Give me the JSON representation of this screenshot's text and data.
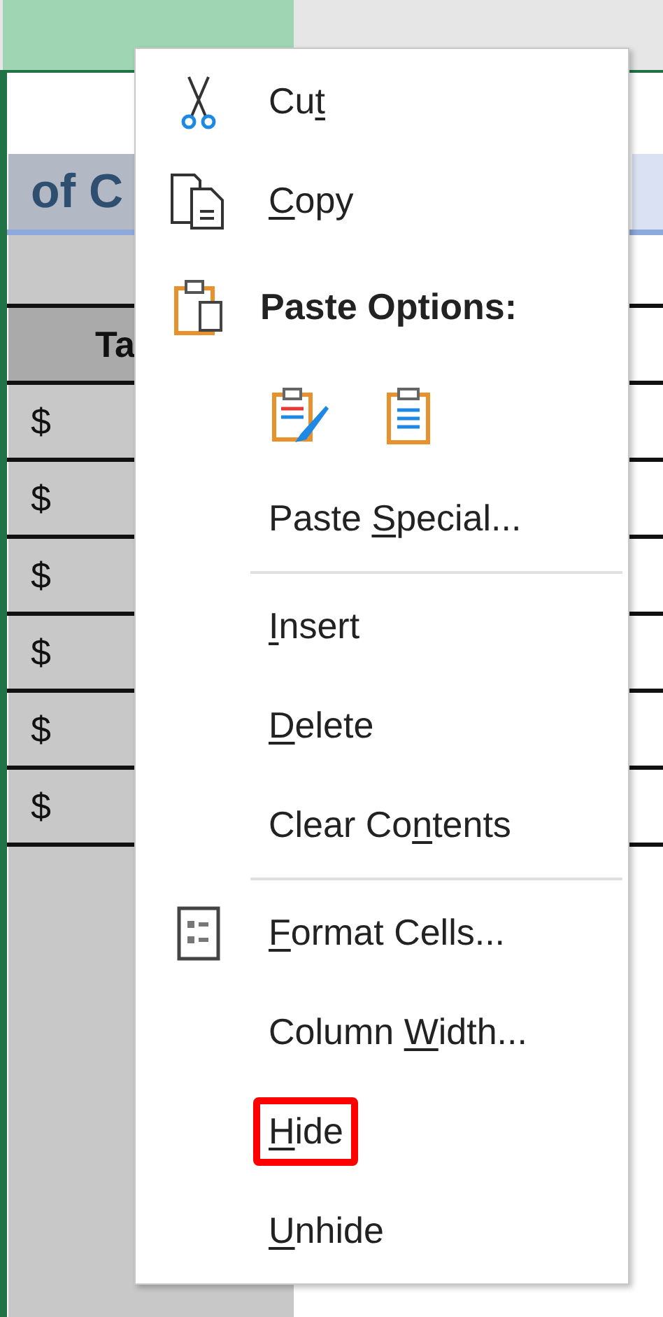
{
  "sheet": {
    "title_fragment": "of C",
    "header_fragment": "Ta",
    "rows": [
      {
        "value": "$"
      },
      {
        "value": "$"
      },
      {
        "value": "$"
      },
      {
        "value": "$"
      },
      {
        "value": "$"
      },
      {
        "value": "$"
      }
    ]
  },
  "context_menu": {
    "items": [
      {
        "kind": "item",
        "before": "Cu",
        "key": "t",
        "highlighted": false
      },
      {
        "kind": "item",
        "key": "C",
        "after": "opy",
        "highlighted": false
      },
      {
        "kind": "heading",
        "text": "Paste Options:"
      },
      {
        "kind": "paste_icons"
      },
      {
        "kind": "item",
        "before": "Paste ",
        "key": "S",
        "after": "pecial...",
        "highlighted": false
      },
      {
        "kind": "separator"
      },
      {
        "kind": "item",
        "key": "I",
        "after": "nsert",
        "highlighted": false
      },
      {
        "kind": "item",
        "key": "D",
        "after": "elete",
        "highlighted": false
      },
      {
        "kind": "item",
        "before": "Clear Co",
        "key": "n",
        "after": "tents",
        "highlighted": false
      },
      {
        "kind": "separator"
      },
      {
        "kind": "item",
        "key": "F",
        "after": "ormat Cells...",
        "highlighted": false
      },
      {
        "kind": "item",
        "before": "Column ",
        "key": "W",
        "after": "idth...",
        "highlighted": false
      },
      {
        "kind": "item",
        "key": "H",
        "after": "ide",
        "highlighted": true
      },
      {
        "kind": "item",
        "key": "U",
        "after": "nhide",
        "highlighted": false
      }
    ]
  }
}
